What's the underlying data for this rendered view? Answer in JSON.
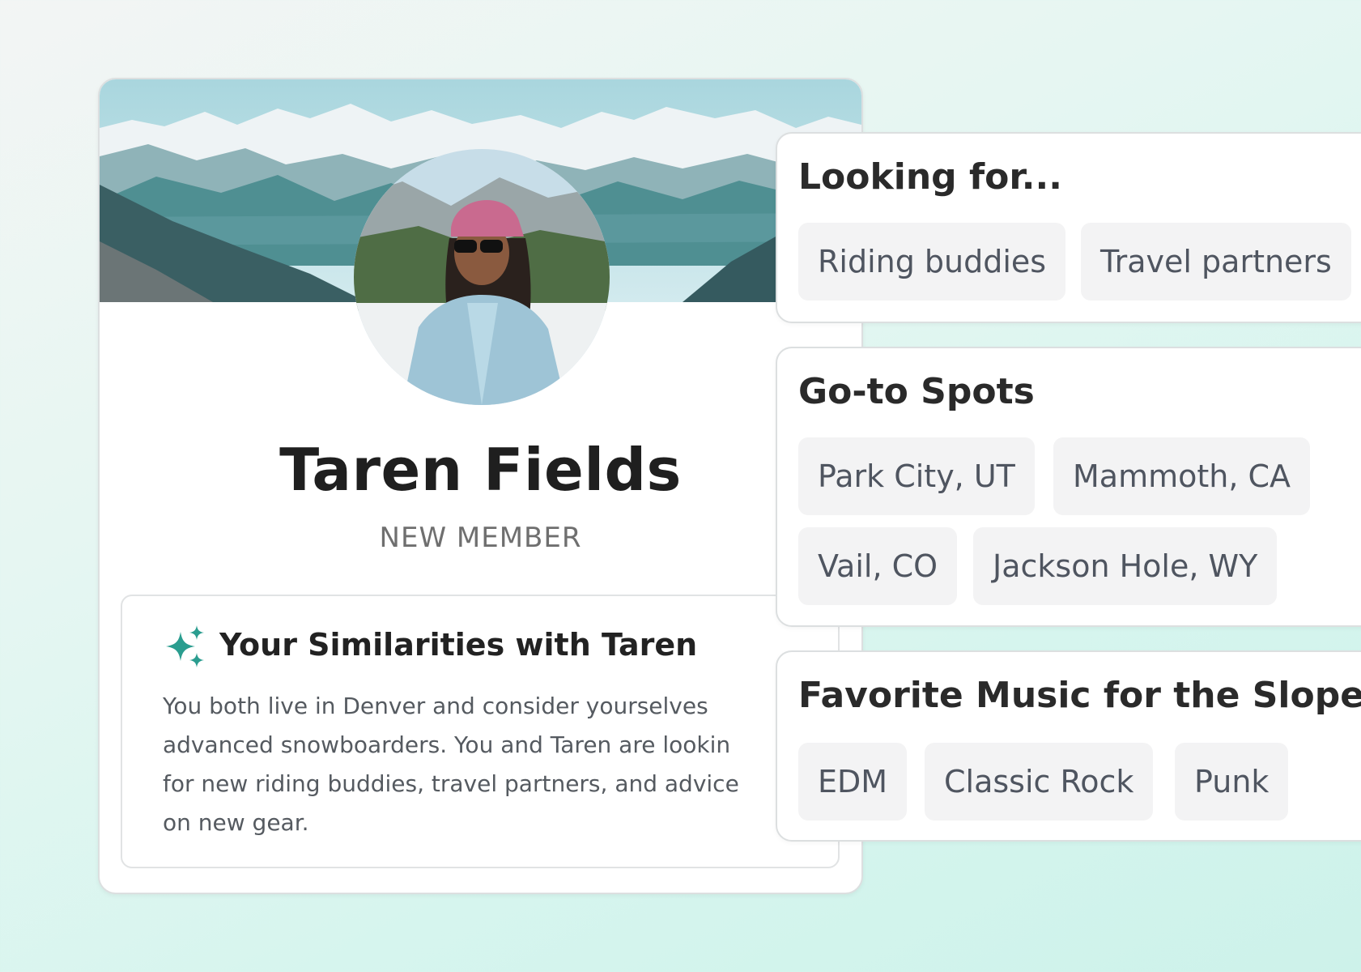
{
  "profile": {
    "name": "Taren Fields",
    "status": "NEW MEMBER"
  },
  "similarities": {
    "title": "Your Similarities with Taren",
    "text": "You both live in Denver and consider yourselves\nadvanced snowboarders. You and Taren are lookin\nfor new riding buddies, travel partners, and advice\non new gear.",
    "icon": "sparkle-icon",
    "accent_color": "#2a9d8f"
  },
  "looking_for": {
    "title": "Looking for...",
    "tags": [
      "Riding buddies",
      "Travel partners"
    ]
  },
  "goto_spots": {
    "title": "Go-to Spots",
    "tags": [
      "Park City, UT",
      "Mammoth, CA",
      "Vail, CO",
      "Jackson Hole, WY"
    ]
  },
  "music": {
    "title": "Favorite Music for the Slopes",
    "tags": [
      "EDM",
      "Classic Rock",
      "Punk"
    ]
  }
}
